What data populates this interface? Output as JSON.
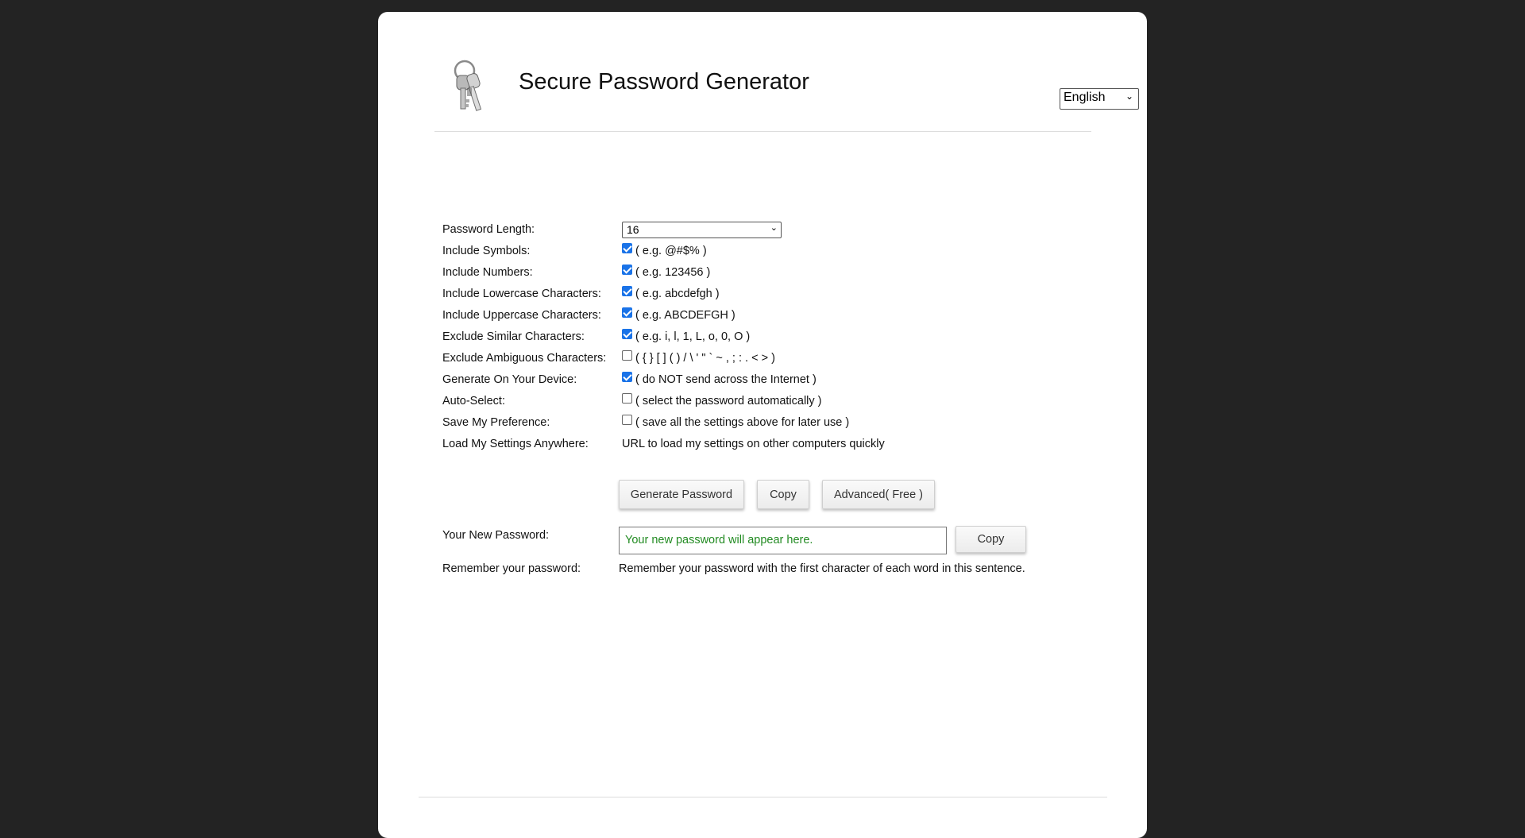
{
  "header": {
    "title": "Secure Password Generator",
    "language": "English",
    "logo_icon": "keys-icon"
  },
  "form": {
    "length": {
      "label": "Password Length:",
      "value": "16"
    },
    "options": [
      {
        "label": "Include Symbols:",
        "checked": true,
        "hint": "( e.g. @#$% )"
      },
      {
        "label": "Include Numbers:",
        "checked": true,
        "hint": "( e.g. 123456 )"
      },
      {
        "label": "Include Lowercase Characters:",
        "checked": true,
        "hint": "( e.g. abcdefgh )"
      },
      {
        "label": "Include Uppercase Characters:",
        "checked": true,
        "hint": "( e.g. ABCDEFGH )"
      },
      {
        "label": "Exclude Similar Characters:",
        "checked": true,
        "hint": "( e.g. i, l, 1, L, o, 0, O )"
      },
      {
        "label": "Exclude Ambiguous Characters:",
        "checked": false,
        "hint": "( { } [ ] ( ) / \\ ' \" ` ~ , ; : . < > )"
      },
      {
        "label": "Generate On Your Device:",
        "checked": true,
        "hint": "( do NOT send across the Internet )"
      },
      {
        "label": "Auto-Select:",
        "checked": false,
        "hint": "( select the password automatically )"
      },
      {
        "label": "Save My Preference:",
        "checked": false,
        "hint": "( save all the settings above for later use )"
      }
    ],
    "load_settings": {
      "label": "Load My Settings Anywhere:",
      "text": "URL to load my settings on other computers quickly"
    }
  },
  "buttons": {
    "generate": "Generate Password",
    "copy": "Copy",
    "advanced": "Advanced( Free )"
  },
  "result": {
    "label": "Your New Password:",
    "placeholder": "Your new password will appear here.",
    "copy": "Copy",
    "remember_label": "Remember your password:",
    "remember_text": "Remember your password with the first character of each word in this sentence."
  }
}
